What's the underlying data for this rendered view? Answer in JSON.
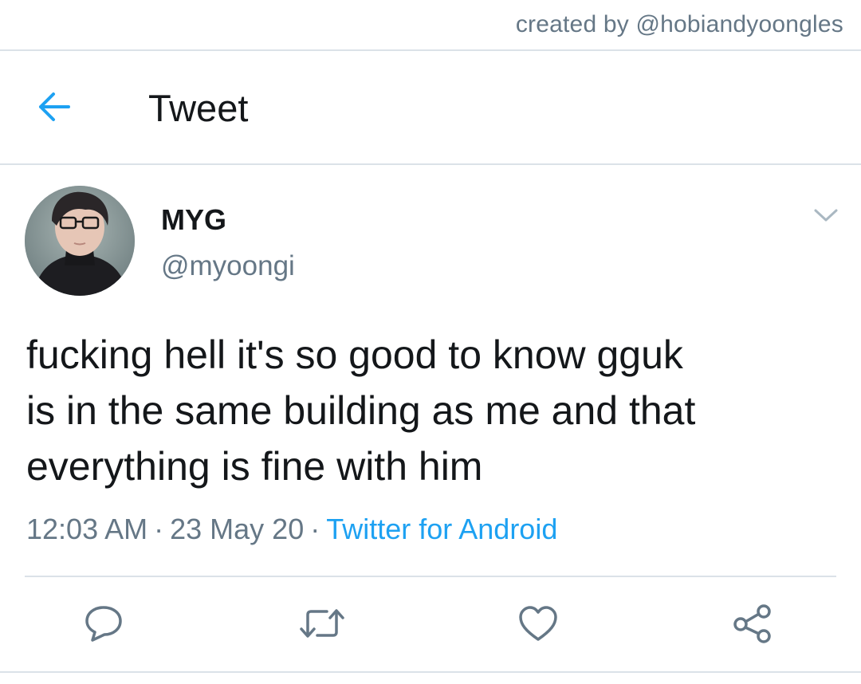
{
  "credit": {
    "text": "created by @hobiandyoongles"
  },
  "header": {
    "back_icon": "arrow-left-icon",
    "title": "Tweet"
  },
  "tweet": {
    "author": {
      "display_name": "MYG",
      "handle": "@myoongi",
      "avatar_icon": "profile-photo"
    },
    "menu_icon": "chevron-down-icon",
    "text": "fucking hell it's so good to know gguk\nis in the same building as me and that\neverything is fine with him",
    "time": "12:03 AM",
    "date": "23 May 20",
    "separator": "·",
    "source": "Twitter for Android"
  },
  "actions": [
    {
      "name": "reply",
      "icon": "speech-bubble-icon"
    },
    {
      "name": "retweet",
      "icon": "retweet-icon"
    },
    {
      "name": "like",
      "icon": "heart-icon"
    },
    {
      "name": "share",
      "icon": "share-icon"
    }
  ],
  "colors": {
    "accent": "#1da1f2",
    "secondary_text": "#657786",
    "primary_text": "#14171a",
    "divider": "#dbe2e8",
    "icon_gray": "#657786"
  }
}
